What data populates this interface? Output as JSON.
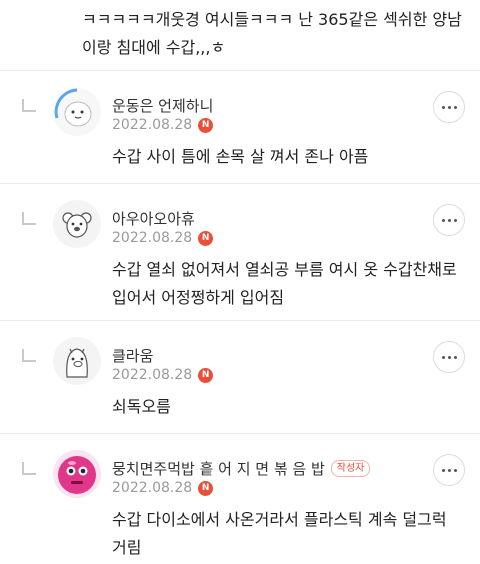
{
  "top_comment": {
    "text": "ㅋㅋㅋㅋㅋ개웃경 여시들ㅋㅋㅋ 난 365같은 섹쉬한 양남이랑 침대에 수갑,,,ㅎ"
  },
  "replies": [
    {
      "nickname": "운동은 언제하니",
      "date": "2022.08.28",
      "new_badge": "N",
      "comment": "수갑 사이 틈에 손목 살 껴서 존나 아픔",
      "avatar_icon": "round-blob-character-icon",
      "author_badge": ""
    },
    {
      "nickname": "아우아오아휴",
      "date": "2022.08.28",
      "new_badge": "N",
      "comment": "수갑 열쇠 없어져서 열쇠공 부름 여시 옷 수갑찬채로 입어서 어정쩡하게 입어짐",
      "avatar_icon": "koala-character-icon",
      "author_badge": ""
    },
    {
      "nickname": "클라움",
      "date": "2022.08.28",
      "new_badge": "N",
      "comment": "쇠독오름",
      "avatar_icon": "pig-character-icon",
      "author_badge": ""
    },
    {
      "nickname": "뭉치면주먹밥 흩 어 지 면 볶 음 밥",
      "date": "2022.08.28",
      "new_badge": "N",
      "comment": "수갑 다이소에서 사온거라서 플라스틱 계속 덜그럭거림",
      "avatar_icon": "pink-ball-character-icon",
      "author_badge": "작성자"
    }
  ],
  "colors": {
    "new_badge": "#e8503a",
    "author_badge": "#e8503a",
    "date": "#9a9a9a",
    "divider": "#ececec"
  }
}
